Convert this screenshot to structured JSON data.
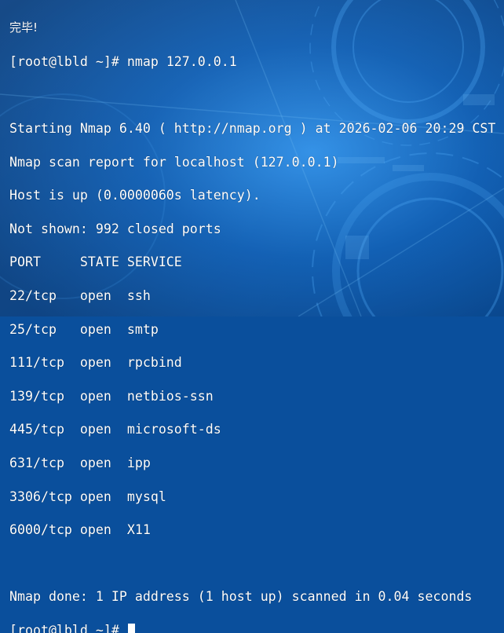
{
  "theme": {
    "background": "#0a4f9c",
    "text": "#ffffff",
    "accent": "#1c73c9"
  },
  "terminal": {
    "lines": [
      "完毕!",
      "[root@lbld ~]# nmap 127.0.0.1",
      "",
      "Starting Nmap 6.40 ( http://nmap.org ) at 2026-02-06 20:29 CST",
      "Nmap scan report for localhost (127.0.0.1)",
      "Host is up (0.0000060s latency).",
      "Not shown: 992 closed ports",
      "PORT     STATE SERVICE",
      "22/tcp   open  ssh",
      "25/tcp   open  smtp",
      "111/tcp  open  rpcbind",
      "139/tcp  open  netbios-ssn",
      "445/tcp  open  microsoft-ds",
      "631/tcp  open  ipp",
      "3306/tcp open  mysql",
      "6000/tcp open  X11",
      "",
      "Nmap done: 1 IP address (1 host up) scanned in 0.04 seconds",
      "[root@lbld ~]# "
    ]
  }
}
